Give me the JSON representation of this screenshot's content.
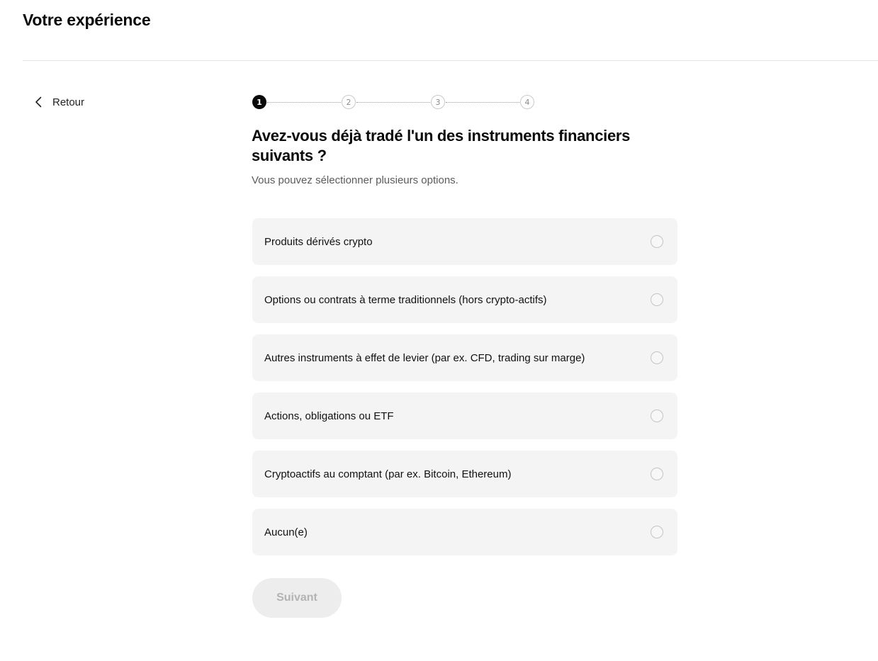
{
  "header": {
    "title": "Votre expérience"
  },
  "nav": {
    "back_label": "Retour",
    "back_icon": "chevron-left-icon"
  },
  "stepper": {
    "current_step": 1,
    "steps": [
      "1",
      "2",
      "3",
      "4"
    ]
  },
  "question": {
    "title": "Avez-vous déjà tradé l'un des instruments financiers suivants ?",
    "hint": "Vous pouvez sélectionner plusieurs options."
  },
  "options": [
    {
      "label": "Produits dérivés crypto",
      "selected": false
    },
    {
      "label": "Options ou contrats à terme traditionnels (hors crypto-actifs)",
      "selected": false
    },
    {
      "label": "Autres instruments à effet de levier (par ex. CFD, trading sur marge)",
      "selected": false
    },
    {
      "label": "Actions, obligations ou ETF",
      "selected": false
    },
    {
      "label": "Cryptoactifs au comptant (par ex. Bitcoin, Ethereum)",
      "selected": false
    },
    {
      "label": "Aucun(e)",
      "selected": false
    }
  ],
  "footer": {
    "next_label": "Suivant",
    "next_disabled": true
  },
  "colors": {
    "accent": "#0a0a0a",
    "option_bg": "#f4f4f4",
    "disabled_bg": "#ededed",
    "disabled_text": "#b3b3b3"
  }
}
